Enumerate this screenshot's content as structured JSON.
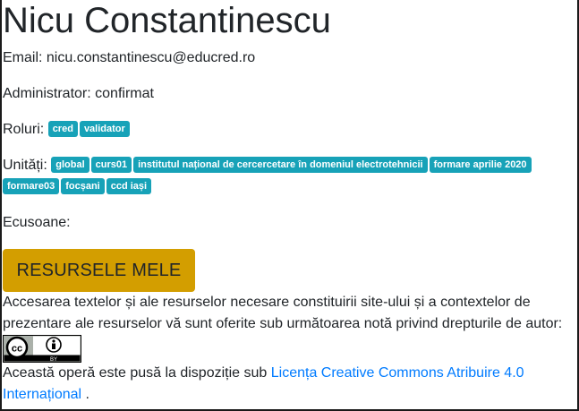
{
  "profile": {
    "name": "Nicu Constantinescu",
    "email_label": "Email:",
    "email": "nicu.constantinescu@educred.ro",
    "admin_label": "Administrator:",
    "admin_status": "confirmat",
    "roles_label": "Roluri:",
    "roles": [
      "cred",
      "validator"
    ],
    "units_label": "Unități:",
    "units": [
      "global",
      "curs01",
      "institutul național de cercercetare în domeniul electrotehnicii",
      "formare aprilie 2020",
      "formare03",
      "focșani",
      "ccd iași"
    ],
    "badges_label": "Ecusoane:"
  },
  "actions": {
    "my_resources_label": "RESURSELE MELE"
  },
  "license": {
    "intro": "Accesarea textelor și ale resurselor necesare constituirii site-ului și a contextelor de prezentare ale resurselor vă sunt oferite sub următoarea notă privind drepturile de autor:",
    "statement_prefix": "Această operă este pusă la dispoziție sub",
    "link_text": "Licența Creative Commons Atribuire 4.0 Internațional",
    "statement_suffix": ".",
    "badge_text": "BY",
    "badge_cc": "cc"
  },
  "colors": {
    "badge": "#17a2b8",
    "button": "#d39e00",
    "link": "#007bff"
  }
}
